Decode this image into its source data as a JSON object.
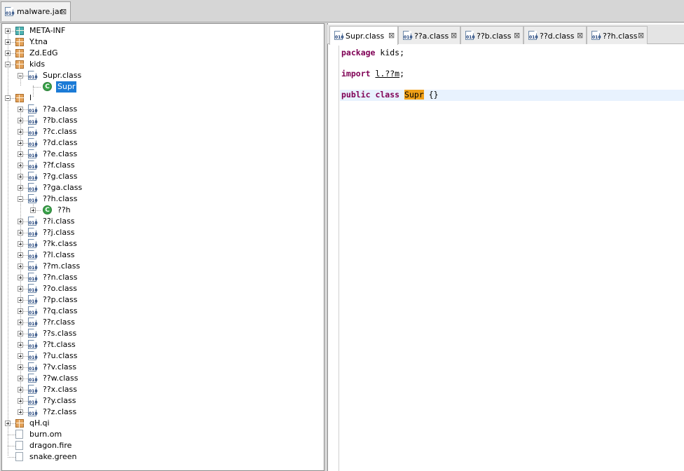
{
  "window": {
    "jar_tab": {
      "label": "malware.jar",
      "close": "⊠"
    }
  },
  "tree": {
    "rows": [
      {
        "label": "META-INF",
        "icon": "package-icon",
        "level": 0,
        "expander": "plus"
      },
      {
        "label": "Y.tna",
        "icon": "package-icon",
        "level": 0,
        "expander": "plus"
      },
      {
        "label": "Zd.EdG",
        "icon": "package-icon",
        "level": 0,
        "expander": "plus"
      },
      {
        "label": "kids",
        "icon": "package-icon",
        "level": 0,
        "expander": "minus"
      },
      {
        "label": "Supr.class",
        "icon": "class-file-icon",
        "level": 1,
        "expander": "minus"
      },
      {
        "label": "Supr",
        "icon": "class-badge-icon",
        "level": 2,
        "expander": "none",
        "selected": true
      },
      {
        "label": "l",
        "icon": "package-icon",
        "level": 0,
        "expander": "minus"
      },
      {
        "label": "??a.class",
        "icon": "class-file-icon",
        "level": 1,
        "expander": "plus"
      },
      {
        "label": "??b.class",
        "icon": "class-file-icon",
        "level": 1,
        "expander": "plus"
      },
      {
        "label": "??c.class",
        "icon": "class-file-icon",
        "level": 1,
        "expander": "plus"
      },
      {
        "label": "??d.class",
        "icon": "class-file-icon",
        "level": 1,
        "expander": "plus"
      },
      {
        "label": "??e.class",
        "icon": "class-file-icon",
        "level": 1,
        "expander": "plus"
      },
      {
        "label": "??f.class",
        "icon": "class-file-icon",
        "level": 1,
        "expander": "plus"
      },
      {
        "label": "??g.class",
        "icon": "class-file-icon",
        "level": 1,
        "expander": "plus"
      },
      {
        "label": "??ga.class",
        "icon": "class-file-icon",
        "level": 1,
        "expander": "plus"
      },
      {
        "label": "??h.class",
        "icon": "class-file-icon",
        "level": 1,
        "expander": "minus"
      },
      {
        "label": "??h",
        "icon": "class-badge-icon",
        "level": 2,
        "expander": "plus"
      },
      {
        "label": "??i.class",
        "icon": "class-file-icon",
        "level": 1,
        "expander": "plus"
      },
      {
        "label": "??j.class",
        "icon": "class-file-icon",
        "level": 1,
        "expander": "plus"
      },
      {
        "label": "??k.class",
        "icon": "class-file-icon",
        "level": 1,
        "expander": "plus"
      },
      {
        "label": "??l.class",
        "icon": "class-file-icon",
        "level": 1,
        "expander": "plus"
      },
      {
        "label": "??m.class",
        "icon": "class-file-icon",
        "level": 1,
        "expander": "plus"
      },
      {
        "label": "??n.class",
        "icon": "class-file-icon",
        "level": 1,
        "expander": "plus"
      },
      {
        "label": "??o.class",
        "icon": "class-file-icon",
        "level": 1,
        "expander": "plus"
      },
      {
        "label": "??p.class",
        "icon": "class-file-icon",
        "level": 1,
        "expander": "plus"
      },
      {
        "label": "??q.class",
        "icon": "class-file-icon",
        "level": 1,
        "expander": "plus"
      },
      {
        "label": "??r.class",
        "icon": "class-file-icon",
        "level": 1,
        "expander": "plus"
      },
      {
        "label": "??s.class",
        "icon": "class-file-icon",
        "level": 1,
        "expander": "plus"
      },
      {
        "label": "??t.class",
        "icon": "class-file-icon",
        "level": 1,
        "expander": "plus"
      },
      {
        "label": "??u.class",
        "icon": "class-file-icon",
        "level": 1,
        "expander": "plus"
      },
      {
        "label": "??v.class",
        "icon": "class-file-icon",
        "level": 1,
        "expander": "plus"
      },
      {
        "label": "??w.class",
        "icon": "class-file-icon",
        "level": 1,
        "expander": "plus"
      },
      {
        "label": "??x.class",
        "icon": "class-file-icon",
        "level": 1,
        "expander": "plus"
      },
      {
        "label": "??y.class",
        "icon": "class-file-icon",
        "level": 1,
        "expander": "plus"
      },
      {
        "label": "??z.class",
        "icon": "class-file-icon",
        "level": 1,
        "expander": "plus"
      },
      {
        "label": "qH.qi",
        "icon": "package-icon",
        "level": 0,
        "expander": "plus"
      },
      {
        "label": "burn.om",
        "icon": "plain-file-icon",
        "level": 0,
        "expander": "none"
      },
      {
        "label": "dragon.fire",
        "icon": "plain-file-icon",
        "level": 0,
        "expander": "none"
      },
      {
        "label": "snake.green",
        "icon": "plain-file-icon",
        "level": 0,
        "expander": "none"
      }
    ]
  },
  "editor": {
    "tabs": [
      {
        "label": "Supr.class",
        "active": true
      },
      {
        "label": "??a.class",
        "active": false
      },
      {
        "label": "??b.class",
        "active": false
      },
      {
        "label": "??d.class",
        "active": false
      },
      {
        "label": "??h.class",
        "active": false
      }
    ],
    "close_glyph": "⊠",
    "code": {
      "line1_kw": "package",
      "line1_rest": " kids;",
      "line2_kw": "import",
      "line2_sp": " ",
      "line2_ref": "l.??m",
      "line2_end": ";",
      "line3_kw": "public class",
      "line3_sp": " ",
      "line3_name": "Supr",
      "line3_end": " {}"
    }
  },
  "colors": {
    "keyword": "#7f0055",
    "selection": "#1c7bd6",
    "highlight": "#f0a018",
    "current_line": "#e8f2fe"
  }
}
